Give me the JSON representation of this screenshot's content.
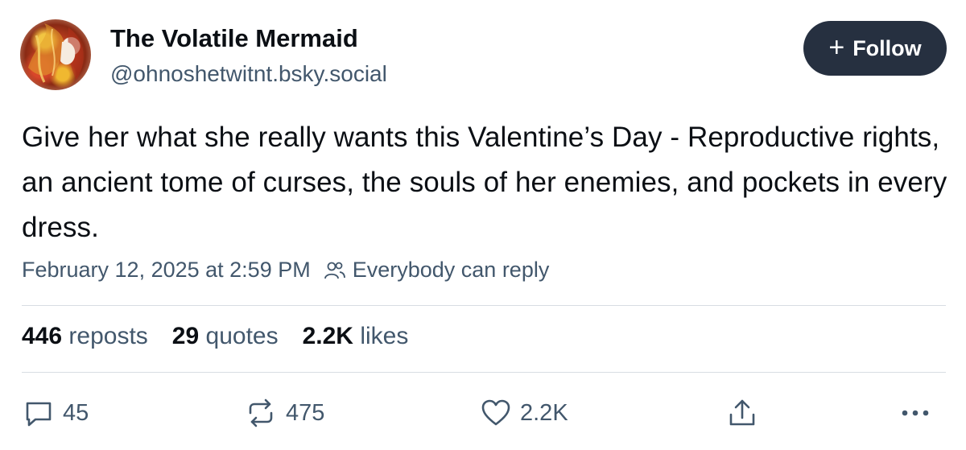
{
  "author": {
    "display_name": "The Volatile Mermaid",
    "handle": "@ohnoshetwitnt.bsky.social",
    "avatar_icon": "profile-avatar"
  },
  "follow_button": {
    "icon": "plus-icon",
    "plus": "+",
    "label": "Follow"
  },
  "post": {
    "text": "Give her what she really wants this Valentine’s Day - Reproductive rights, an ancient tome of curses, the souls of her enemies, and pockets in every dress.",
    "timestamp": "February 12, 2025 at 2:59 PM",
    "reply_setting": "Everybody can reply"
  },
  "stats": {
    "reposts_count": "446",
    "reposts_label": "reposts",
    "quotes_count": "29",
    "quotes_label": "quotes",
    "likes_count": "2.2K",
    "likes_label": "likes"
  },
  "actions": {
    "reply_count": "45",
    "repost_count": "475",
    "like_count": "2.2K",
    "share_icon": "share-icon",
    "more_icon": "more-icon"
  },
  "colors": {
    "follow_bg": "#263040",
    "muted_text": "#42576c",
    "divider": "#d8dde3"
  }
}
